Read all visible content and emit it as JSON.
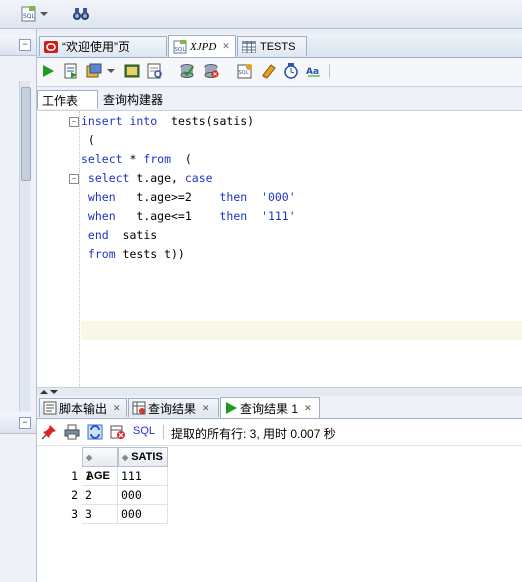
{
  "topbar": {
    "icons": [
      "sql-dropdown-icon",
      "binoculars-icon"
    ]
  },
  "document_tabs": [
    {
      "label": "“欢迎使用”页",
      "icon": "oracle-icon"
    },
    {
      "label": "XJPD",
      "icon": "sql-icon"
    },
    {
      "label": "TESTS",
      "icon": "table-icon"
    }
  ],
  "editor_subtabs": [
    {
      "label": "工作表"
    },
    {
      "label": "查询构建器"
    }
  ],
  "code_lines": [
    {
      "parts": [
        {
          "t": "insert into",
          "k": 1
        },
        {
          "t": "  tests(satis)",
          "k": 0
        }
      ]
    },
    {
      "parts": [
        {
          "t": " (",
          "k": 0
        }
      ]
    },
    {
      "parts": [
        {
          "t": "select",
          "k": 1
        },
        {
          "t": " * ",
          "k": 0
        },
        {
          "t": "from",
          "k": 1
        },
        {
          "t": "  (",
          "k": 0
        }
      ]
    },
    {
      "parts": [
        {
          "t": " select",
          "k": 1
        },
        {
          "t": " t.age, ",
          "k": 0
        },
        {
          "t": "case",
          "k": 1
        }
      ]
    },
    {
      "parts": [
        {
          "t": " when",
          "k": 1
        },
        {
          "t": "   t.age>=2    ",
          "k": 0
        },
        {
          "t": "then",
          "k": 1
        },
        {
          "t": "  '000'",
          "k": 2
        }
      ]
    },
    {
      "parts": [
        {
          "t": " when",
          "k": 1
        },
        {
          "t": "   t.age<=1    ",
          "k": 0
        },
        {
          "t": "then",
          "k": 1
        },
        {
          "t": "  '111'",
          "k": 2
        }
      ]
    },
    {
      "parts": [
        {
          "t": " end",
          "k": 1
        },
        {
          "t": "  satis",
          "k": 0
        }
      ]
    },
    {
      "parts": [
        {
          "t": " from",
          "k": 1
        },
        {
          "t": " tests t))",
          "k": 0
        }
      ]
    }
  ],
  "result_tabs": [
    {
      "label": "脚本输出",
      "icon": "script-output-icon"
    },
    {
      "label": "查询结果",
      "icon": "query-result-icon"
    },
    {
      "label": "查询结果 1",
      "icon": "run-icon"
    }
  ],
  "result_toolbar": {
    "sql_label": "SQL",
    "status": "提取的所有行: 3, 用时 0.007 秒"
  },
  "grid": {
    "columns": [
      "AGE",
      "SATIS"
    ],
    "rows": [
      {
        "num": "1",
        "age": "1",
        "satis": "111"
      },
      {
        "num": "2",
        "age": "2",
        "satis": "000"
      },
      {
        "num": "3",
        "age": "3",
        "satis": "000"
      }
    ]
  },
  "colors": {
    "keyword": "#1c33c8",
    "accent": "#3a6bc4"
  }
}
